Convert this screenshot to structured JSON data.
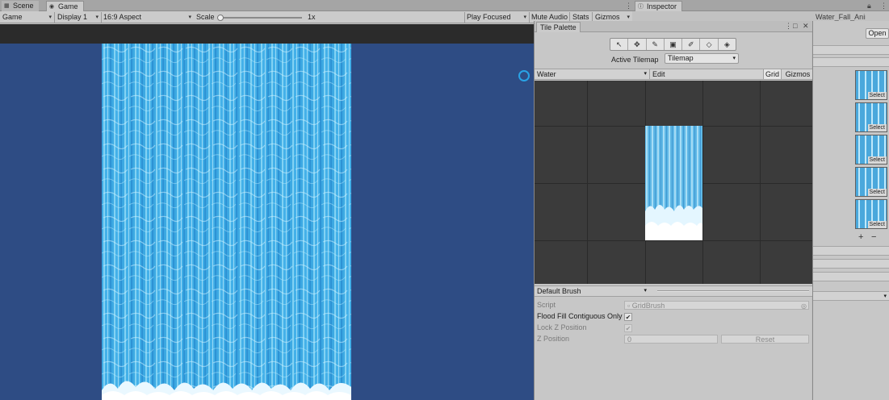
{
  "tabs": {
    "scene": "Scene",
    "game": "Game",
    "inspector": "Inspector",
    "tile_palette": "Tile Palette",
    "kebab": "⋮"
  },
  "game_toolbar": {
    "view_mode": "Game",
    "display": "Display 1",
    "aspect": "16:9 Aspect",
    "scale_label": "Scale",
    "scale_value": "1x",
    "play_mode": "Play Focused",
    "mute": "Mute Audio",
    "stats": "Stats",
    "gizmos": "Gizmos"
  },
  "inspector": {
    "asset_title": "Water_Fall_Animated_Tile (Animated Tile)",
    "open_label": "Open",
    "plus": "+",
    "minus": "−",
    "thumb_label": "Select",
    "thumb_count": 5
  },
  "tile_palette": {
    "tools": [
      "select-tool",
      "move-tool",
      "paint-tool",
      "box-fill-tool",
      "picker-tool",
      "erase-tool",
      "fill-tool"
    ],
    "tool_glyphs": [
      "↖",
      "✥",
      "✎",
      "▣",
      "✐",
      "◇",
      "◈"
    ],
    "active_tilemap_label": "Active Tilemap",
    "active_tilemap_value": "Tilemap",
    "palette_value": "Water",
    "edit_label": "Edit",
    "grid_label": "Grid",
    "gizmos_label": "Gizmos",
    "brush_value": "Default Brush",
    "props": {
      "script_label": "Script",
      "script_value": "GridBrush",
      "flood_label": "Flood Fill Contiguous Only",
      "lockz_label": "Lock Z Position",
      "zpos_label": "Z Position",
      "zpos_value": "0",
      "reset_label": "Reset"
    }
  },
  "colors": {
    "game_background": "#2e4c84",
    "water_light": "#8fdcf7",
    "water_mid": "#36a6e0",
    "water_dark": "#1d78c2",
    "cursor_ring": "#29a3e6"
  }
}
